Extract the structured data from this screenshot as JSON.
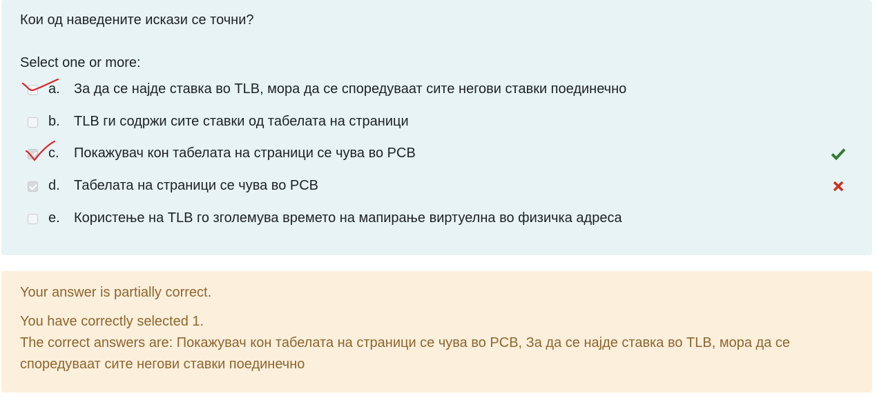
{
  "question": {
    "text": "Кои од наведените искази се точни?",
    "prompt": "Select one or more:"
  },
  "answers": [
    {
      "letter": "a.",
      "text": "За да се најде ставка во TLB, мора да се споредуваат сите негови ставки поединечно",
      "checked": false,
      "mark": ""
    },
    {
      "letter": "b.",
      "text": "TLB ги содржи сите ставки од табелата на страници",
      "checked": false,
      "mark": ""
    },
    {
      "letter": "c.",
      "text": "Покажувач кон табелата на страници се чува во PCB",
      "checked": true,
      "mark": "correct"
    },
    {
      "letter": "d.",
      "text": "Табелата на страници се чува во PCB",
      "checked": true,
      "mark": "incorrect"
    },
    {
      "letter": "e.",
      "text": "Користење на TLB го зголемува времето на мапирање виртуелна во физичка адреса",
      "checked": false,
      "mark": ""
    }
  ],
  "icons": {
    "correct": "check-icon",
    "incorrect": "cross-icon"
  },
  "colors": {
    "question_bg": "#e7f3f5",
    "feedback_bg": "#fcefdc",
    "feedback_text": "#8e662e",
    "correct": "#357a32",
    "incorrect": "#ca3120",
    "pen": "#d9262b"
  },
  "feedback": {
    "status": "Your answer is partially correct.",
    "selected": "You have correctly selected 1.",
    "correct_answers_line1": "The correct answers are: Покажувач кон табелата на страници се чува во PCB, За да се најде ставка во TLB, мора да се",
    "correct_answers_line2": "споредуваат сите негови ставки поединечно"
  }
}
